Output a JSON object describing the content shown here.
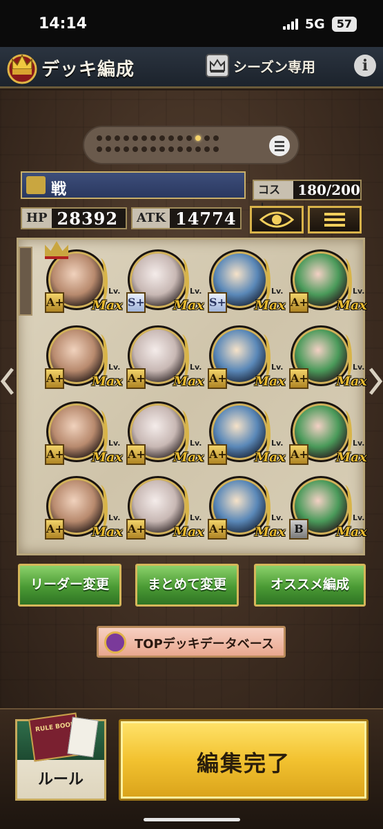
{
  "status_bar": {
    "time": "14:14",
    "network": "5G",
    "battery": "57"
  },
  "header": {
    "title": "デッキ編成",
    "season_label": "シーズン専用",
    "info_label": "i"
  },
  "deck": {
    "name": "戦",
    "cost_label": "コスト",
    "cost_value": "180/200",
    "hp_label": "HP",
    "hp_value": "28392",
    "atk_label": "ATK",
    "atk_value": "14774"
  },
  "pager": {
    "total": 28,
    "active_index": 11
  },
  "cards": [
    {
      "rank": "A+",
      "lv_label": "Lv.",
      "lv": "Max",
      "leader": true
    },
    {
      "rank": "S+",
      "lv_label": "Lv.",
      "lv": "Max"
    },
    {
      "rank": "S+",
      "lv_label": "Lv.",
      "lv": "Max"
    },
    {
      "rank": "A+",
      "lv_label": "Lv.",
      "lv": "Max"
    },
    {
      "rank": "A+",
      "lv_label": "Lv.",
      "lv": "Max"
    },
    {
      "rank": "A+",
      "lv_label": "Lv.",
      "lv": "Max"
    },
    {
      "rank": "A+",
      "lv_label": "Lv.",
      "lv": "Max"
    },
    {
      "rank": "A+",
      "lv_label": "Lv.",
      "lv": "Max"
    },
    {
      "rank": "A+",
      "lv_label": "Lv.",
      "lv": "Max"
    },
    {
      "rank": "A+",
      "lv_label": "Lv.",
      "lv": "Max"
    },
    {
      "rank": "A+",
      "lv_label": "Lv.",
      "lv": "Max"
    },
    {
      "rank": "A+",
      "lv_label": "Lv.",
      "lv": "Max"
    },
    {
      "rank": "A+",
      "lv_label": "Lv.",
      "lv": "Max"
    },
    {
      "rank": "A+",
      "lv_label": "Lv.",
      "lv": "Max"
    },
    {
      "rank": "A+",
      "lv_label": "Lv.",
      "lv": "Max"
    },
    {
      "rank": "B",
      "lv_label": "Lv.",
      "lv": "Max"
    }
  ],
  "actions": {
    "leader_change": "リーダー変更",
    "bulk_change": "まとめて変更",
    "recommend": "オススメ編成",
    "top_database": "TOPデッキデータベース"
  },
  "bottom": {
    "rule_label": "ルール",
    "rule_book_title": "RULE BOOK",
    "done_label": "編集完了"
  },
  "colors": {
    "accent_gold": "#d9b34a",
    "button_green": "#4a9a34",
    "done_yellow": "#f2c230"
  }
}
